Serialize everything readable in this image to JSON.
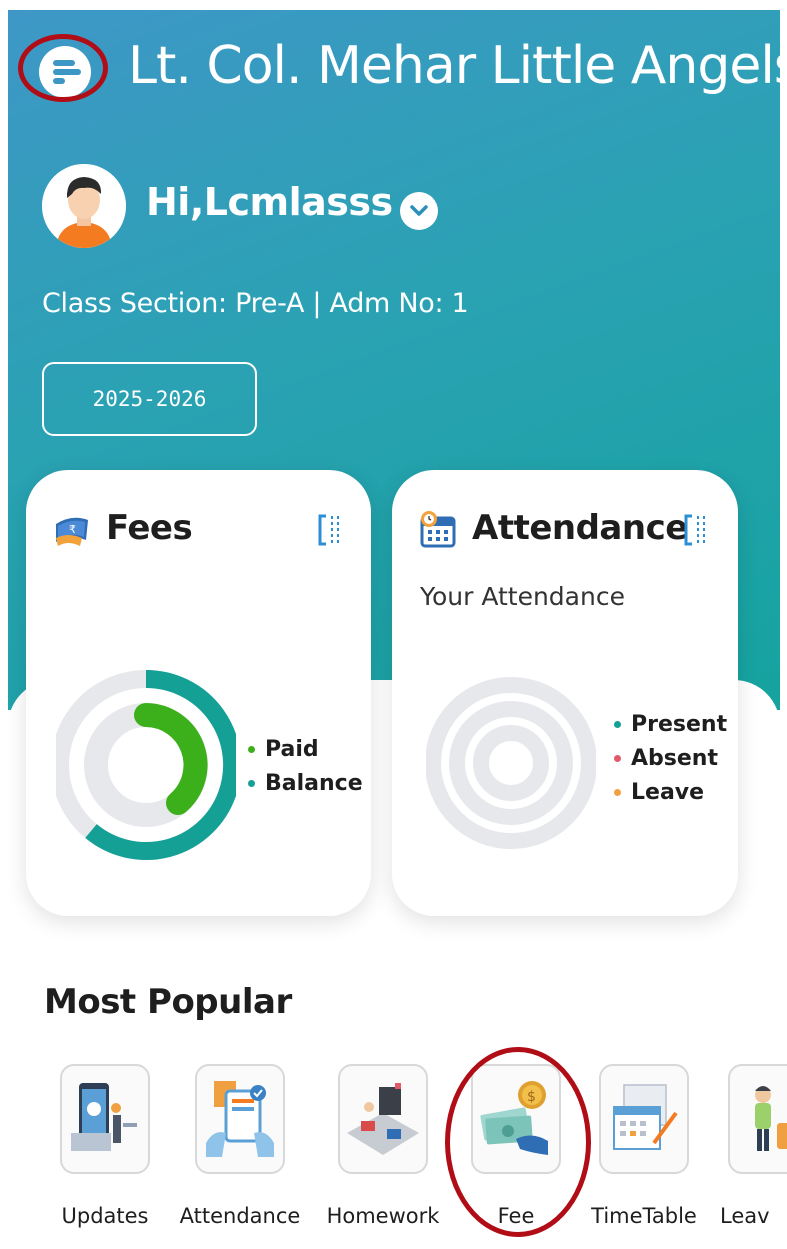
{
  "header": {
    "school_name": "Lt. Col. Mehar Little Angels...",
    "menu_icon": "menu-icon"
  },
  "profile": {
    "greeting": "Hi,Lcmlasss",
    "class_info": "Class Section: Pre-A | Adm No: 1",
    "session": "2025-2026"
  },
  "fees_card": {
    "title": "Fees",
    "legend": [
      "Paid",
      "Balance"
    ],
    "colors": {
      "paid": "#3cb01a",
      "balance": "#15a096",
      "track": "#e6e8eb"
    }
  },
  "attendance_card": {
    "title": "Attendance",
    "subtitle": "Your Attendance",
    "legend": [
      "Present",
      "Absent",
      "Leave"
    ],
    "colors": {
      "present": "#15a096",
      "absent": "#e05a6a",
      "leave": "#f0a040"
    }
  },
  "most_popular": {
    "title": "Most Popular",
    "items": [
      {
        "label": "Updates"
      },
      {
        "label": "Attendance"
      },
      {
        "label": "Homework"
      },
      {
        "label": "Fee"
      },
      {
        "label": "TimeTable"
      },
      {
        "label": "Leav"
      }
    ]
  }
}
